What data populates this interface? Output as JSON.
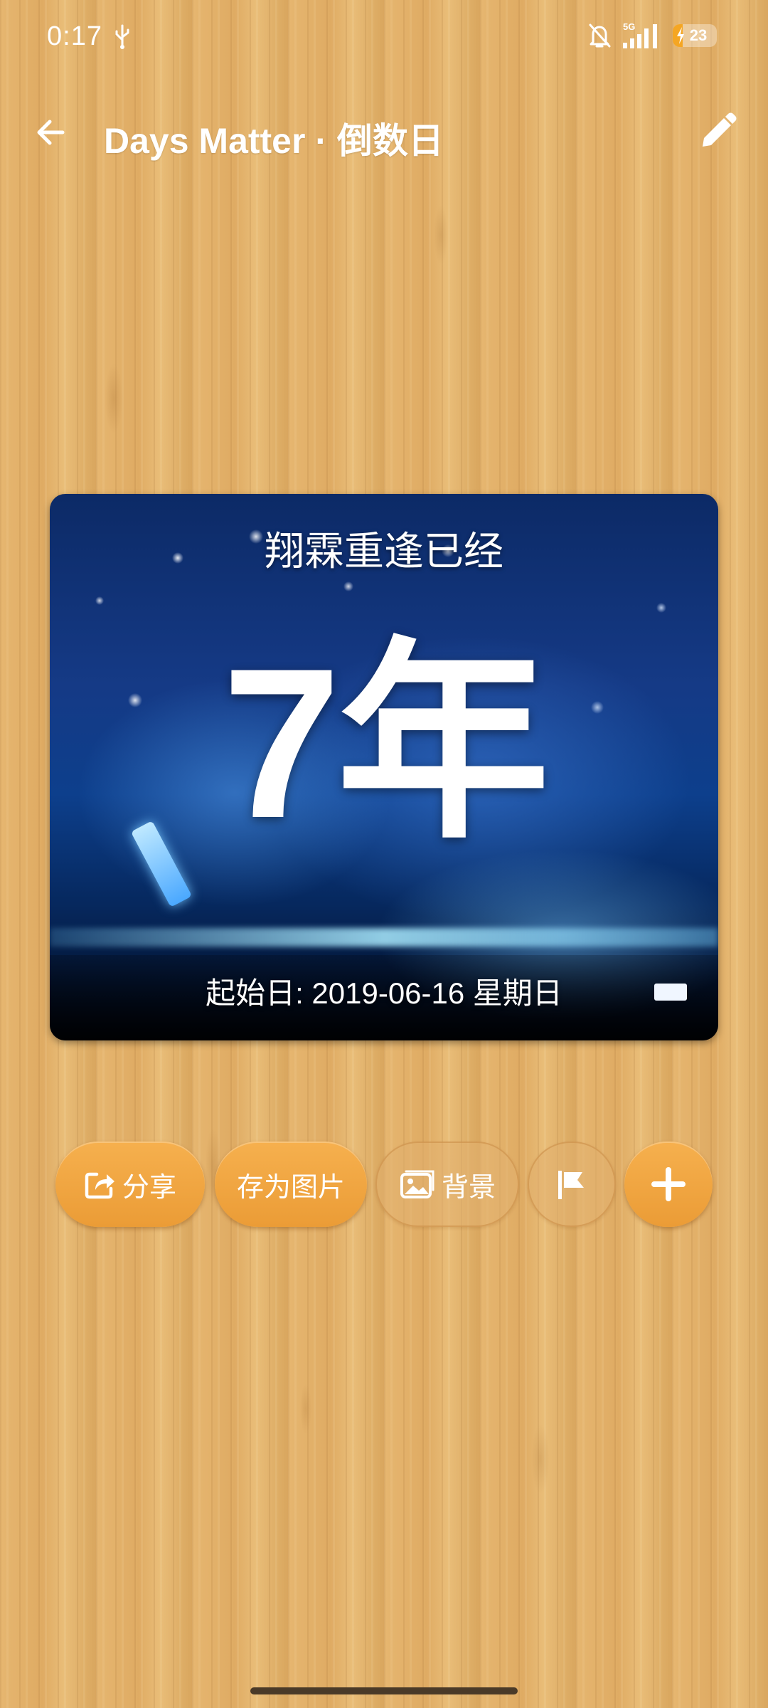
{
  "status_bar": {
    "time": "0:17",
    "network": "5G",
    "battery": "23",
    "battery_level": 0.23,
    "icons": [
      "usb-icon",
      "bell-off-icon",
      "signal-icon",
      "battery-icon"
    ]
  },
  "app_bar": {
    "title": "Days Matter · 倒数日",
    "back_icon": "arrow-left-icon",
    "edit_icon": "pencil-icon"
  },
  "card": {
    "title": "翔霖重逢已经",
    "value": "7年",
    "start_date": "起始日: 2019-06-16 星期日"
  },
  "actions": {
    "share_label": "分享",
    "save_image_label": "存为图片",
    "background_label": "背景",
    "flag_icon": "flag-icon",
    "add_icon": "plus-icon"
  },
  "colors": {
    "accent": "#F0A440",
    "text": "#FFFFFF"
  }
}
